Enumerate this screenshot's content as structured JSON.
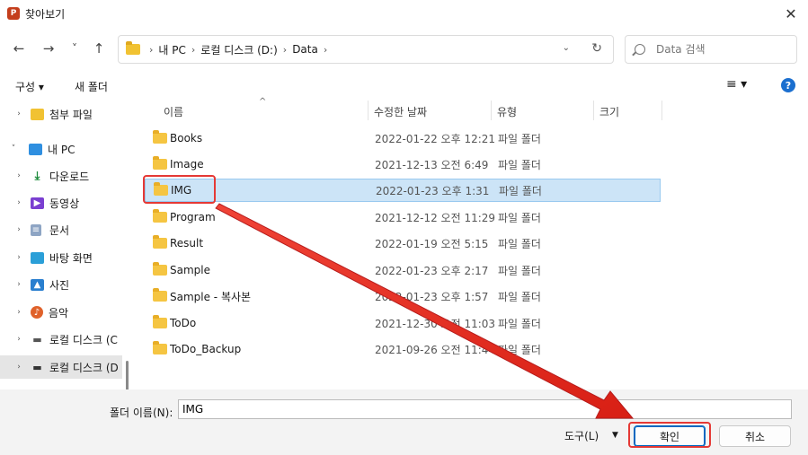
{
  "window": {
    "title": "찾아보기",
    "app_icon_letter": "P",
    "close_glyph": "✕"
  },
  "nav": {
    "back": "←",
    "forward": "→",
    "recent": "˅",
    "up": "↑",
    "breadcrumbs": [
      "내 PC",
      "로컬 디스크 (D:)",
      "Data"
    ],
    "separator": "›",
    "dropdown": "⌄",
    "refresh": "↻",
    "search_placeholder": "Data 검색"
  },
  "toolbar": {
    "organize": "구성 ▾",
    "new_folder": "새 폴더",
    "view": "≡ ▾",
    "help": "?"
  },
  "sidebar": {
    "items": [
      {
        "label": "첨부 파일",
        "chevron": "›",
        "icon": "folder-icon",
        "color": "#f1c232"
      },
      {
        "label": "내 PC",
        "chevron": "˅",
        "icon": "computer-icon",
        "color": "#2f8fe0"
      },
      {
        "label": "다운로드",
        "chevron": "›",
        "icon": "download-icon",
        "color": "#1b8a3a"
      },
      {
        "label": "동영상",
        "chevron": "›",
        "icon": "video-icon",
        "color": "#7a3fd1"
      },
      {
        "label": "문서",
        "chevron": "›",
        "icon": "document-icon",
        "color": "#8ea5c4"
      },
      {
        "label": "바탕 화면",
        "chevron": "›",
        "icon": "desktop-icon",
        "color": "#2b9fd8"
      },
      {
        "label": "사진",
        "chevron": "›",
        "icon": "pictures-icon",
        "color": "#2a7fcf"
      },
      {
        "label": "음악",
        "chevron": "›",
        "icon": "music-icon",
        "color": "#e0622b"
      },
      {
        "label": "로컬 디스크 (C",
        "chevron": "›",
        "icon": "drive-c-icon",
        "color": "#555555"
      },
      {
        "label": "로컬 디스크 (D",
        "chevron": "›",
        "icon": "drive-d-icon",
        "color": "#333333"
      }
    ]
  },
  "columns": {
    "name": "이름",
    "date": "수정한 날짜",
    "type": "유형",
    "size": "크기",
    "sort_caret": "^"
  },
  "files": [
    {
      "name": "Books",
      "date": "2022-01-22 오후 12:21",
      "type": "파일 폴더"
    },
    {
      "name": "Image",
      "date": "2021-12-13 오전 6:49",
      "type": "파일 폴더"
    },
    {
      "name": "IMG",
      "date": "2022-01-23 오후 1:31",
      "type": "파일 폴더",
      "selected": true
    },
    {
      "name": "Program",
      "date": "2021-12-12 오전 11:29",
      "type": "파일 폴더"
    },
    {
      "name": "Result",
      "date": "2022-01-19 오전 5:15",
      "type": "파일 폴더"
    },
    {
      "name": "Sample",
      "date": "2022-01-23 오후 2:17",
      "type": "파일 폴더"
    },
    {
      "name": "Sample - 복사본",
      "date": "2022-01-23 오후 1:57",
      "type": "파일 폴더"
    },
    {
      "name": "ToDo",
      "date": "2021-12-30 오전 11:03",
      "type": "파일 폴더"
    },
    {
      "name": "ToDo_Backup",
      "date": "2021-09-26 오전 11:44",
      "type": "파일 폴더"
    }
  ],
  "footer": {
    "folder_name_label": "폴더 이름(N):",
    "folder_name_value": "IMG",
    "tools": "도구(L)",
    "tools_dd": "▼",
    "ok": "확인",
    "cancel": "취소"
  },
  "colors": {
    "annotation_red": "#e53935",
    "selection": "#cce4f7",
    "accent": "#0067c0"
  }
}
